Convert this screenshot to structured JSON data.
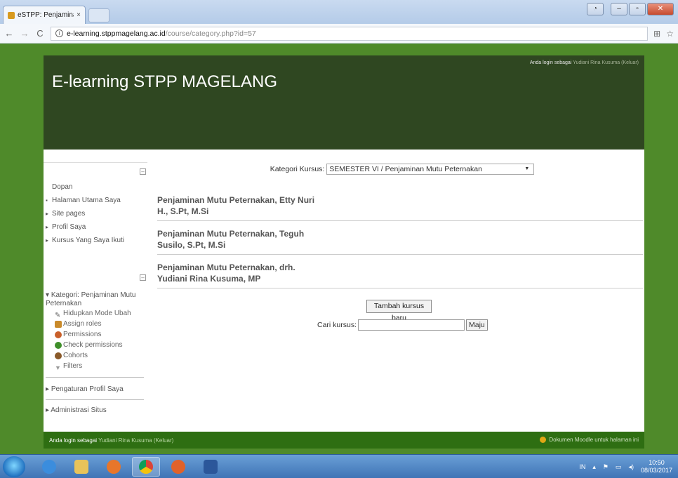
{
  "browser": {
    "tab_title": "eSTPP: Penjaminan Mut",
    "tab_close": "×",
    "url_host": "e-learning.stppmagelang.ac.id",
    "url_path": "/course/category.php?id=57"
  },
  "header": {
    "site_title": "E-learning STPP MAGELANG",
    "login_prefix": "Anda login sebagai",
    "login_user": "Yudiani Rina Kusuma",
    "login_logout": "(Keluar)"
  },
  "nav_block": {
    "items": [
      {
        "label": "Dopan",
        "mark": ""
      },
      {
        "label": "Halaman Utama Saya",
        "mark": "▪"
      },
      {
        "label": "Site pages",
        "mark": "▸"
      },
      {
        "label": "Profil Saya",
        "mark": "▸"
      },
      {
        "label": "Kursus Yang Saya Ikuti",
        "mark": "▸"
      }
    ]
  },
  "admin_block": {
    "category_label": "Kategori: Penjaminan Mutu Peternakan",
    "children": [
      {
        "label": "Hidupkan Mode Ubah",
        "icon": "pencil-icon",
        "color": "#777777"
      },
      {
        "label": "Assign roles",
        "icon": "roles-icon",
        "color": "#c98a2a"
      },
      {
        "label": "Permissions",
        "icon": "permissions-icon",
        "color": "#c9602a"
      },
      {
        "label": "Check permissions",
        "icon": "check-permissions-icon",
        "color": "#3f8f2a"
      },
      {
        "label": "Cohorts",
        "icon": "cohorts-icon",
        "color": "#8a5a2a"
      },
      {
        "label": "Filters",
        "icon": "filter-icon",
        "color": "#9a9a9a"
      }
    ],
    "profile_settings": "Pengaturan Profil Saya",
    "site_admin": "Administrasi Situs"
  },
  "main": {
    "category_label": "Kategori Kursus:",
    "category_value": "SEMESTER VI / Penjaminan Mutu Peternakan",
    "courses": [
      "Penjaminan Mutu Peternakan, Etty Nuri H., S.Pt, M.Si",
      "Penjaminan Mutu Peternakan, Teguh Susilo, S.Pt, M.Si",
      "Penjaminan Mutu Peternakan, drh. Yudiani Rina Kusuma, MP"
    ],
    "add_course_button": "Tambah kursus baru",
    "search_label": "Cari kursus:",
    "search_value": "",
    "search_button": "Maju"
  },
  "footer": {
    "login_prefix": "Anda login sebagai",
    "login_user": "Yudiani Rina Kusuma",
    "login_logout": "(Keluar)",
    "doc_link": "Dokumen Moodle untuk halaman ini"
  },
  "taskbar": {
    "lang": "IN",
    "time": "10:50",
    "date": "08/03/2017"
  },
  "colors": {
    "page_bg": "#4f8a2a",
    "header_bg": "#2f4721",
    "footer_bg": "#2e6e12"
  }
}
